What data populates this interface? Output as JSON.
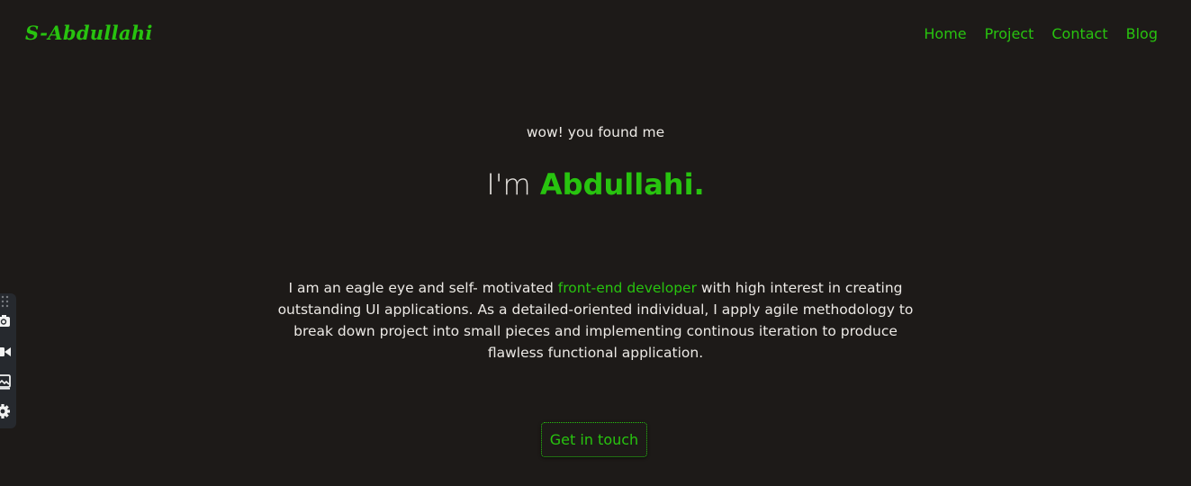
{
  "header": {
    "logo": "S-Abdullahi",
    "nav": [
      {
        "label": "Home"
      },
      {
        "label": "Project"
      },
      {
        "label": "Contact"
      },
      {
        "label": "Blog"
      }
    ]
  },
  "hero": {
    "tagline": "wow! you found me",
    "greeting": "I'm",
    "name": "Abdullahi.",
    "bio": {
      "before": "I am an eagle eye and self- motivated ",
      "highlight": "front-end developer",
      "after": " with high interest in creating outstanding UI applications. As a detailed-oriented individual, I apply agile methodology to break down project into small pieces and implementing continous iteration to produce flawless functional application."
    },
    "cta_label": "Get in touch"
  },
  "side_toolbar": {
    "icons": [
      "grip-icon",
      "camera-icon",
      "video-icon",
      "image-icon",
      "settings-icon"
    ]
  },
  "colors": {
    "background": "#1d1a18",
    "accent": "#28c30f",
    "text": "#ece9e5",
    "toolbar": "#26292e"
  }
}
